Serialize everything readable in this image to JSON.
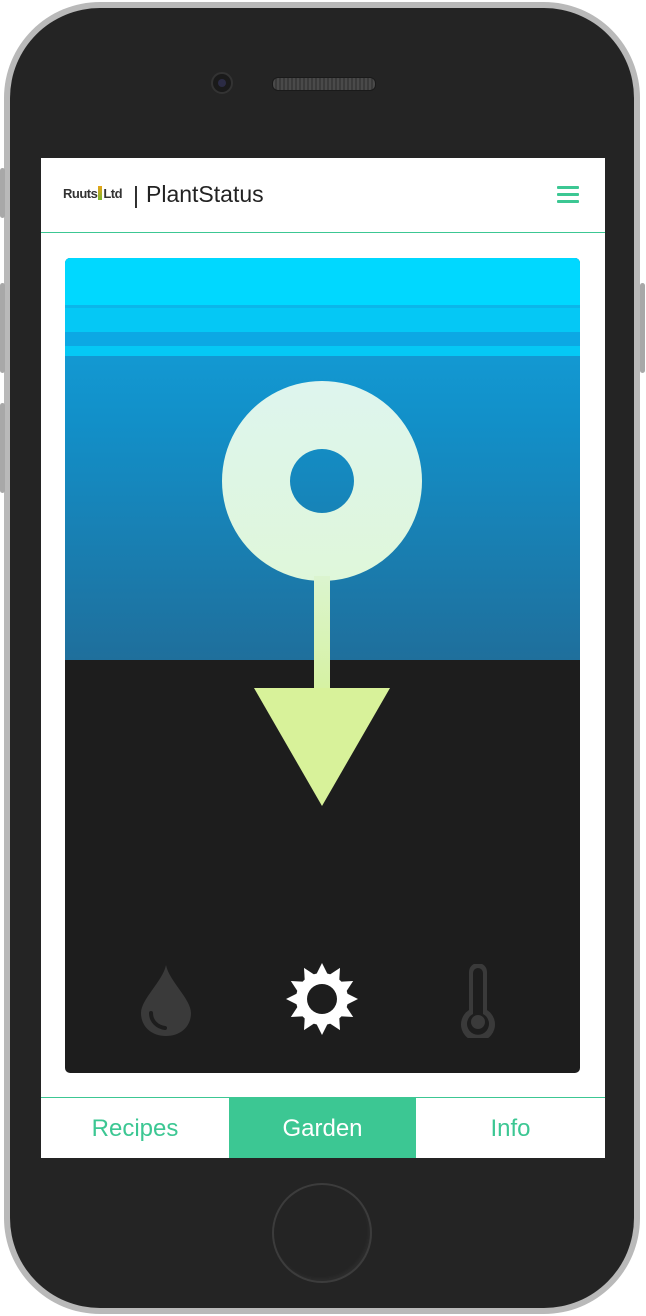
{
  "header": {
    "logo_text_left": "Ruuts",
    "logo_text_right": "Ltd",
    "divider": "|",
    "title": "PlantStatus",
    "menu_icon": "hamburger-icon"
  },
  "status_card": {
    "icons": [
      "water-drop-icon",
      "sun-icon",
      "thermometer-icon"
    ],
    "selected_icon": "sun-icon",
    "indicator": "sun-arrow-down-symbol",
    "colors": {
      "water_top": "#00d8ff",
      "water_gradient_top": "#15a6e0",
      "water_gradient_bottom": "#1f6f9c",
      "soil": "#1d1d1d",
      "symbol_ring": "#dff5e6",
      "symbol_arrow": "#d8f29a"
    }
  },
  "tabs": [
    {
      "label": "Recipes",
      "active": false
    },
    {
      "label": "Garden",
      "active": true
    },
    {
      "label": "Info",
      "active": false
    }
  ],
  "theme": {
    "accent": "#3cc793"
  }
}
